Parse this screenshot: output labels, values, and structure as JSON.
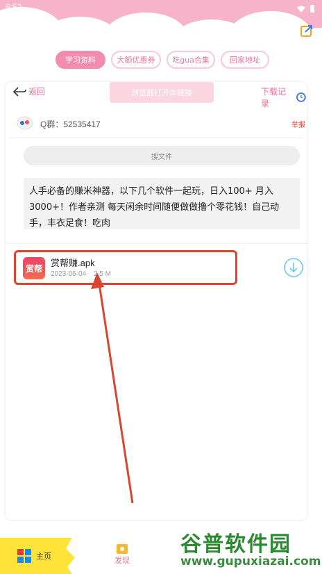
{
  "status_bar": {
    "time": "9:52"
  },
  "tabs": [
    {
      "label": "学习资料",
      "active": true
    },
    {
      "label": "大额优惠券",
      "active": false
    },
    {
      "label": "吃gua合集",
      "active": false
    },
    {
      "label": "回家地址",
      "active": false
    }
  ],
  "toolbar": {
    "back_label": "返回",
    "browser_label": "浏览器打开本链接",
    "download_label": "下载记录"
  },
  "group": {
    "qq_text": "Q群：52535417",
    "report_label": "举报"
  },
  "search": {
    "placeholder": "搜文件"
  },
  "description": "人手必备的赚米神器，以下几个软件一起玩，日入100+ 月入3000+！作者亲测 每天闲余时间随便做做撸个零花钱！自己动手，丰衣足食！吃肉",
  "file": {
    "icon_text": "赏帮",
    "name": "赏帮赚.apk",
    "date": "2023-06-04",
    "size": "2.5 M"
  },
  "bottom_nav": {
    "home_label": "主页",
    "discover_label": "发现"
  },
  "watermark": {
    "title": "谷普软件园",
    "url": "www.gupuxiazai.com"
  },
  "colors": {
    "accent_pink": "#f48cb0",
    "header_pink": "#f7b3c9",
    "highlight_red": "#d9462f",
    "home_yellow": "#ffe338"
  }
}
